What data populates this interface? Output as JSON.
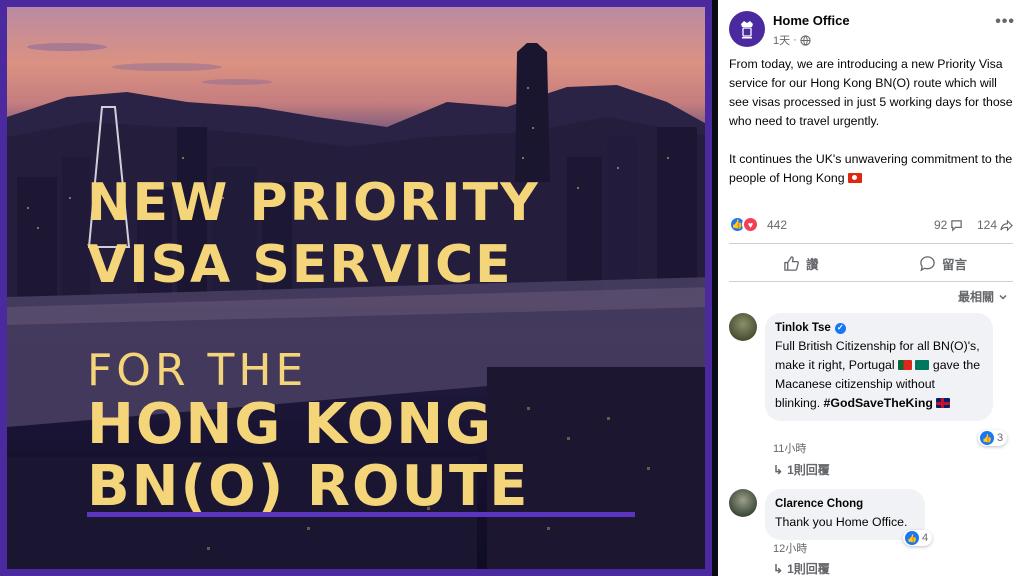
{
  "image_panel": {
    "headline_line1": "NEW PRIORITY",
    "headline_line2": "VISA SERVICE",
    "headline_line3": "FOR THE",
    "headline_line4": "HONG KONG",
    "headline_line5": "BN(O) ROUTE",
    "accent_color": "#f4d57a",
    "frame_color": "#4b2aa0"
  },
  "post": {
    "page_name": "Home Office",
    "time": "1天",
    "audience_icon": "globe-icon",
    "menu_icon": "more-icon",
    "paragraph1": "From today, we are introducing a new Priority Visa service for our Hong Kong BN(O) route which will see visas processed in just 5 working days for those who need to travel urgently.",
    "paragraph2": "It continues the UK's unwavering commitment to the people of Hong Kong",
    "reactions_count": "442",
    "comments_count": "92",
    "shares_count": "124",
    "like_label": "讚",
    "comment_label": "留言",
    "sort_label": "最相關"
  },
  "comments": [
    {
      "author": "Tinlok Tse",
      "verified": true,
      "text_part1": "Full British Citizenship for all BN(O)'s, make it right, Portugal",
      "text_part2": "gave the Macanese citizenship without blinking.",
      "hashtag": "#GodSaveTheKing",
      "time": "11小時",
      "likes": "3",
      "replies": "1則回覆"
    },
    {
      "author": "Clarence Chong",
      "verified": false,
      "text": "Thank you Home Office.",
      "time": "12小時",
      "likes": "4",
      "replies": "1則回覆"
    }
  ]
}
